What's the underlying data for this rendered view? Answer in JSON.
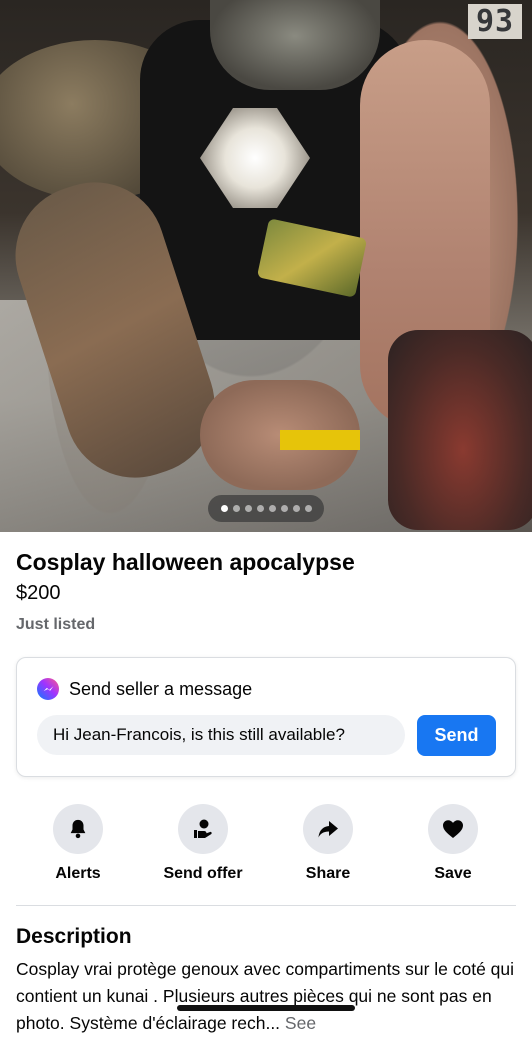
{
  "photo": {
    "alt_overlay_number": "93",
    "carousel": {
      "count": 8,
      "active_index": 0
    }
  },
  "listing": {
    "title": "Cosplay halloween apocalypse",
    "price": "$200",
    "listed": "Just listed"
  },
  "message": {
    "heading": "Send seller a message",
    "input_value": "Hi Jean-Francois, is this still available?",
    "send_label": "Send"
  },
  "actions": [
    {
      "label": "Alerts",
      "icon": "bell-icon"
    },
    {
      "label": "Send offer",
      "icon": "offer-icon"
    },
    {
      "label": "Share",
      "icon": "share-icon"
    },
    {
      "label": "Save",
      "icon": "heart-icon"
    }
  ],
  "description": {
    "heading": "Description",
    "text": "Cosplay vrai protège genoux avec compartiments sur le coté qui contient un   kunai . Plusieurs autres pièces qui ne sont pas en photo.  Système d'éclairage rech...",
    "see_more": "See"
  },
  "colors": {
    "accent": "#1877f2",
    "muted": "#65676b",
    "chip": "#e4e6eb"
  }
}
